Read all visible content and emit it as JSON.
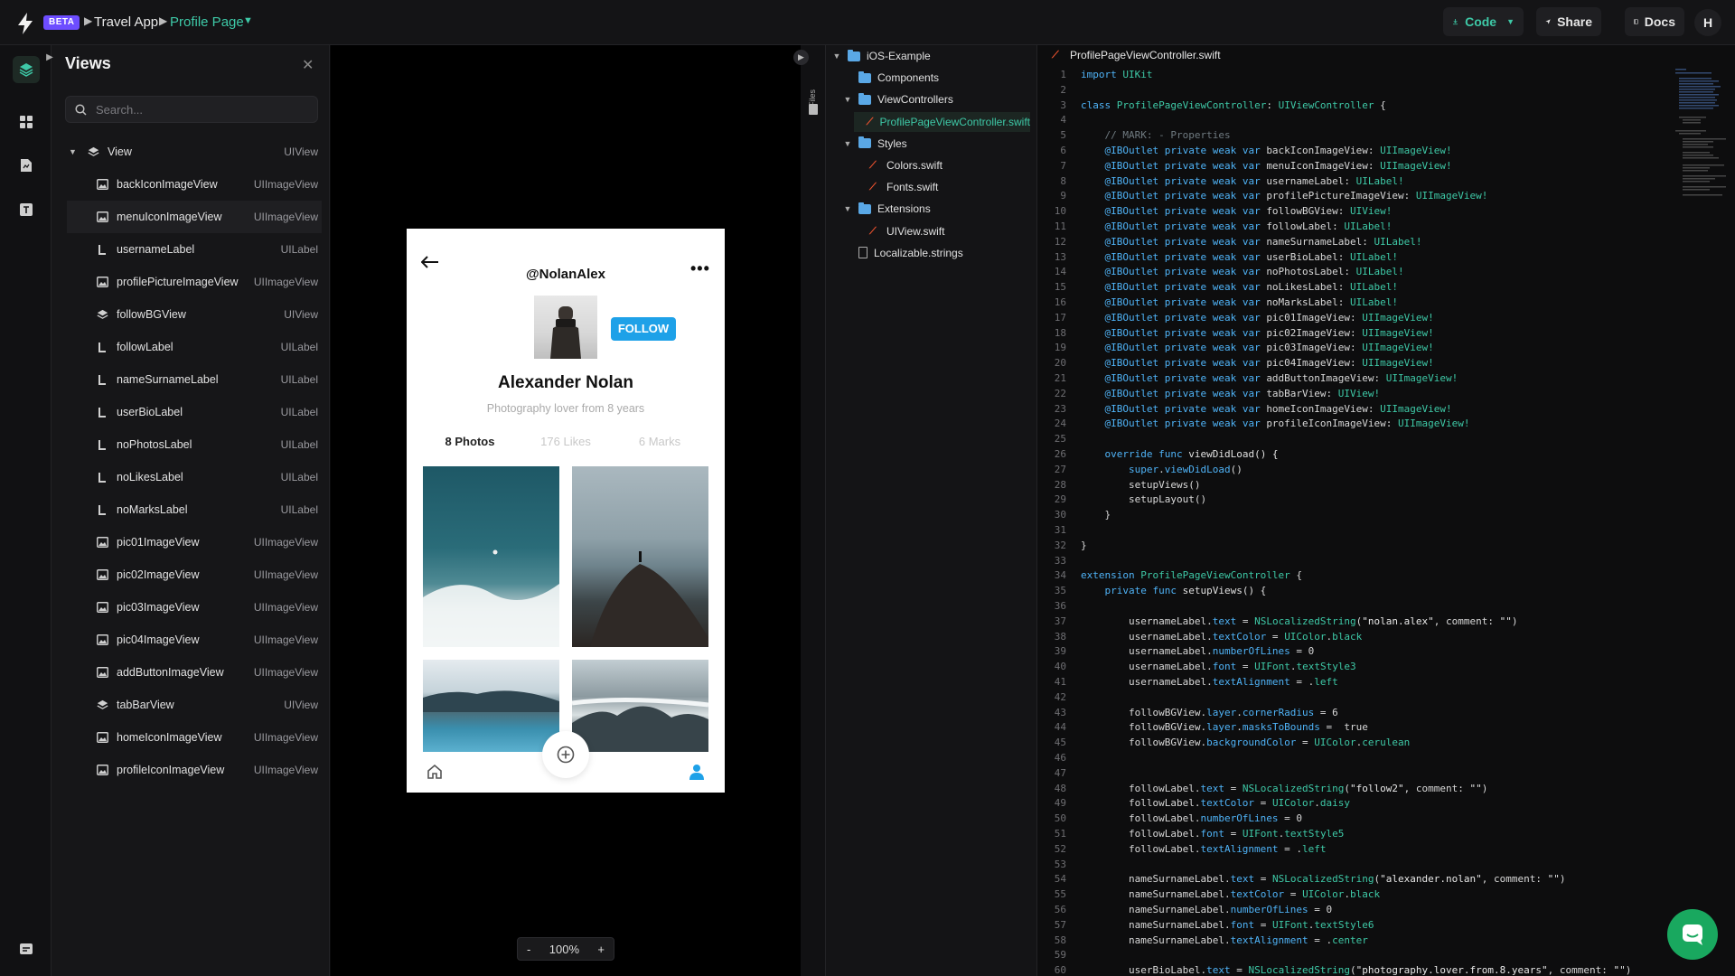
{
  "topbar": {
    "beta": "BETA",
    "crumb_app": "Travel App",
    "crumb_page": "Profile Page",
    "code_label": "Code",
    "share_label": "Share",
    "docs_label": "Docs",
    "avatar_letter": "H"
  },
  "views": {
    "title": "Views",
    "search_placeholder": "Search...",
    "items": [
      {
        "name": "View",
        "type": "UIView",
        "icon": "layers-icon"
      },
      {
        "name": "backIconImageView",
        "type": "UIImageView",
        "icon": "image-icon"
      },
      {
        "name": "menuIconImageView",
        "type": "UIImageView",
        "icon": "image-icon"
      },
      {
        "name": "usernameLabel",
        "type": "UILabel",
        "icon": "label-icon"
      },
      {
        "name": "profilePictureImageView",
        "type": "UIImageView",
        "icon": "image-icon"
      },
      {
        "name": "followBGView",
        "type": "UIView",
        "icon": "layers-icon"
      },
      {
        "name": "followLabel",
        "type": "UILabel",
        "icon": "label-icon"
      },
      {
        "name": "nameSurnameLabel",
        "type": "UILabel",
        "icon": "label-icon"
      },
      {
        "name": "userBioLabel",
        "type": "UILabel",
        "icon": "label-icon"
      },
      {
        "name": "noPhotosLabel",
        "type": "UILabel",
        "icon": "label-icon"
      },
      {
        "name": "noLikesLabel",
        "type": "UILabel",
        "icon": "label-icon"
      },
      {
        "name": "noMarksLabel",
        "type": "UILabel",
        "icon": "label-icon"
      },
      {
        "name": "pic01ImageView",
        "type": "UIImageView",
        "icon": "image-icon"
      },
      {
        "name": "pic02ImageView",
        "type": "UIImageView",
        "icon": "image-icon"
      },
      {
        "name": "pic03ImageView",
        "type": "UIImageView",
        "icon": "image-icon"
      },
      {
        "name": "pic04ImageView",
        "type": "UIImageView",
        "icon": "image-icon"
      },
      {
        "name": "addButtonImageView",
        "type": "UIImageView",
        "icon": "image-icon"
      },
      {
        "name": "tabBarView",
        "type": "UIView",
        "icon": "layers-icon"
      },
      {
        "name": "homeIconImageView",
        "type": "UIImageView",
        "icon": "image-icon"
      },
      {
        "name": "profileIconImageView",
        "type": "UIImageView",
        "icon": "image-icon"
      }
    ]
  },
  "phone": {
    "username": "@NolanAlex",
    "follow": "FOLLOW",
    "name": "Alexander Nolan",
    "bio": "Photography lover from 8 years",
    "photos": "8 Photos",
    "likes": "176 Likes",
    "marks": "6 Marks"
  },
  "zoom": {
    "minus": "-",
    "value": "100%",
    "plus": "+"
  },
  "files_label": "Files",
  "tree": [
    {
      "label": "iOS-Example",
      "kind": "folder",
      "depth": 0,
      "chev": "▼"
    },
    {
      "label": "Components",
      "kind": "folder",
      "depth": 1,
      "chev": ""
    },
    {
      "label": "ViewControllers",
      "kind": "folder",
      "depth": 1,
      "chev": "▼"
    },
    {
      "label": "ProfilePageViewController.swift",
      "kind": "swift",
      "depth": 2,
      "chev": "",
      "selected": true
    },
    {
      "label": "Styles",
      "kind": "folder",
      "depth": 1,
      "chev": "▼"
    },
    {
      "label": "Colors.swift",
      "kind": "swift",
      "depth": 2,
      "chev": ""
    },
    {
      "label": "Fonts.swift",
      "kind": "swift",
      "depth": 2,
      "chev": ""
    },
    {
      "label": "Extensions",
      "kind": "folder",
      "depth": 1,
      "chev": "▼"
    },
    {
      "label": "UIView.swift",
      "kind": "swift",
      "depth": 2,
      "chev": ""
    },
    {
      "label": "Localizable.strings",
      "kind": "doc",
      "depth": 1,
      "chev": ""
    }
  ],
  "editor": {
    "filename": "ProfilePageViewController.swift",
    "lines": [
      [
        [
          "kw",
          "import "
        ],
        [
          "ty",
          "UIKit"
        ]
      ],
      [],
      [
        [
          "kw",
          "class "
        ],
        [
          "ty",
          "ProfilePageViewController"
        ],
        [
          "tx",
          ": "
        ],
        [
          "ty",
          "UIViewController"
        ],
        [
          "tx",
          " {"
        ]
      ],
      [],
      [
        [
          "tx",
          "    "
        ],
        [
          "cm",
          "// MARK: - Properties"
        ]
      ],
      [
        [
          "tx",
          "    "
        ],
        [
          "kw",
          "@IBOutlet private weak var "
        ],
        [
          "tx",
          "backIconImageView: "
        ],
        [
          "ty",
          "UIImageView!"
        ]
      ],
      [
        [
          "tx",
          "    "
        ],
        [
          "kw",
          "@IBOutlet private weak var "
        ],
        [
          "tx",
          "menuIconImageView: "
        ],
        [
          "ty",
          "UIImageView!"
        ]
      ],
      [
        [
          "tx",
          "    "
        ],
        [
          "kw",
          "@IBOutlet private weak var "
        ],
        [
          "tx",
          "usernameLabel: "
        ],
        [
          "ty",
          "UILabel!"
        ]
      ],
      [
        [
          "tx",
          "    "
        ],
        [
          "kw",
          "@IBOutlet private weak var "
        ],
        [
          "tx",
          "profilePictureImageView: "
        ],
        [
          "ty",
          "UIImageView!"
        ]
      ],
      [
        [
          "tx",
          "    "
        ],
        [
          "kw",
          "@IBOutlet private weak var "
        ],
        [
          "tx",
          "followBGView: "
        ],
        [
          "ty",
          "UIView!"
        ]
      ],
      [
        [
          "tx",
          "    "
        ],
        [
          "kw",
          "@IBOutlet private weak var "
        ],
        [
          "tx",
          "followLabel: "
        ],
        [
          "ty",
          "UILabel!"
        ]
      ],
      [
        [
          "tx",
          "    "
        ],
        [
          "kw",
          "@IBOutlet private weak var "
        ],
        [
          "tx",
          "nameSurnameLabel: "
        ],
        [
          "ty",
          "UILabel!"
        ]
      ],
      [
        [
          "tx",
          "    "
        ],
        [
          "kw",
          "@IBOutlet private weak var "
        ],
        [
          "tx",
          "userBioLabel: "
        ],
        [
          "ty",
          "UILabel!"
        ]
      ],
      [
        [
          "tx",
          "    "
        ],
        [
          "kw",
          "@IBOutlet private weak var "
        ],
        [
          "tx",
          "noPhotosLabel: "
        ],
        [
          "ty",
          "UILabel!"
        ]
      ],
      [
        [
          "tx",
          "    "
        ],
        [
          "kw",
          "@IBOutlet private weak var "
        ],
        [
          "tx",
          "noLikesLabel: "
        ],
        [
          "ty",
          "UILabel!"
        ]
      ],
      [
        [
          "tx",
          "    "
        ],
        [
          "kw",
          "@IBOutlet private weak var "
        ],
        [
          "tx",
          "noMarksLabel: "
        ],
        [
          "ty",
          "UILabel!"
        ]
      ],
      [
        [
          "tx",
          "    "
        ],
        [
          "kw",
          "@IBOutlet private weak var "
        ],
        [
          "tx",
          "pic01ImageView: "
        ],
        [
          "ty",
          "UIImageView!"
        ]
      ],
      [
        [
          "tx",
          "    "
        ],
        [
          "kw",
          "@IBOutlet private weak var "
        ],
        [
          "tx",
          "pic02ImageView: "
        ],
        [
          "ty",
          "UIImageView!"
        ]
      ],
      [
        [
          "tx",
          "    "
        ],
        [
          "kw",
          "@IBOutlet private weak var "
        ],
        [
          "tx",
          "pic03ImageView: "
        ],
        [
          "ty",
          "UIImageView!"
        ]
      ],
      [
        [
          "tx",
          "    "
        ],
        [
          "kw",
          "@IBOutlet private weak var "
        ],
        [
          "tx",
          "pic04ImageView: "
        ],
        [
          "ty",
          "UIImageView!"
        ]
      ],
      [
        [
          "tx",
          "    "
        ],
        [
          "kw",
          "@IBOutlet private weak var "
        ],
        [
          "tx",
          "addButtonImageView: "
        ],
        [
          "ty",
          "UIImageView!"
        ]
      ],
      [
        [
          "tx",
          "    "
        ],
        [
          "kw",
          "@IBOutlet private weak var "
        ],
        [
          "tx",
          "tabBarView: "
        ],
        [
          "ty",
          "UIView!"
        ]
      ],
      [
        [
          "tx",
          "    "
        ],
        [
          "kw",
          "@IBOutlet private weak var "
        ],
        [
          "tx",
          "homeIconImageView: "
        ],
        [
          "ty",
          "UIImageView!"
        ]
      ],
      [
        [
          "tx",
          "    "
        ],
        [
          "kw",
          "@IBOutlet private weak var "
        ],
        [
          "tx",
          "profileIconImageView: "
        ],
        [
          "ty",
          "UIImageView!"
        ]
      ],
      [],
      [
        [
          "tx",
          "    "
        ],
        [
          "kw",
          "override func "
        ],
        [
          "fn",
          "viewDidLoad() {"
        ]
      ],
      [
        [
          "tx",
          "        "
        ],
        [
          "kw",
          "super"
        ],
        [
          "tx",
          "."
        ],
        [
          "pr",
          "viewDidLoad"
        ],
        [
          "tx",
          "()"
        ]
      ],
      [
        [
          "tx",
          "        setupViews()"
        ]
      ],
      [
        [
          "tx",
          "        setupLayout()"
        ]
      ],
      [
        [
          "tx",
          "    }"
        ]
      ],
      [],
      [
        [
          "tx",
          "}"
        ]
      ],
      [],
      [
        [
          "kw",
          "extension "
        ],
        [
          "ty",
          "ProfilePageViewController"
        ],
        [
          "tx",
          " {"
        ]
      ],
      [
        [
          "tx",
          "    "
        ],
        [
          "kw",
          "private func "
        ],
        [
          "fn",
          "setupViews() {"
        ]
      ],
      [],
      [
        [
          "tx",
          "        usernameLabel."
        ],
        [
          "pr",
          "text"
        ],
        [
          "tx",
          " = "
        ],
        [
          "ty",
          "NSLocalizedString"
        ],
        [
          "tx",
          "("
        ],
        [
          "st",
          "\"nolan.alex\""
        ],
        [
          "tx",
          ", comment: "
        ],
        [
          "st",
          "\"\""
        ],
        [
          "tx",
          ")"
        ]
      ],
      [
        [
          "tx",
          "        usernameLabel."
        ],
        [
          "pr",
          "textColor"
        ],
        [
          "tx",
          " = "
        ],
        [
          "ty",
          "UIColor"
        ],
        [
          "tx",
          "."
        ],
        [
          "ty",
          "black"
        ]
      ],
      [
        [
          "tx",
          "        usernameLabel."
        ],
        [
          "pr",
          "numberOfLines"
        ],
        [
          "tx",
          " = 0"
        ]
      ],
      [
        [
          "tx",
          "        usernameLabel."
        ],
        [
          "pr",
          "font"
        ],
        [
          "tx",
          " = "
        ],
        [
          "ty",
          "UIFont"
        ],
        [
          "tx",
          "."
        ],
        [
          "ty",
          "textStyle3"
        ]
      ],
      [
        [
          "tx",
          "        usernameLabel."
        ],
        [
          "pr",
          "textAlignment"
        ],
        [
          "tx",
          " = ."
        ],
        [
          "ty",
          "left"
        ]
      ],
      [],
      [
        [
          "tx",
          "        followBGView."
        ],
        [
          "pr",
          "layer"
        ],
        [
          "tx",
          "."
        ],
        [
          "pr",
          "cornerRadius"
        ],
        [
          "tx",
          " = 6"
        ]
      ],
      [
        [
          "tx",
          "        followBGView."
        ],
        [
          "pr",
          "layer"
        ],
        [
          "tx",
          "."
        ],
        [
          "pr",
          "masksToBounds"
        ],
        [
          "tx",
          " =  true"
        ]
      ],
      [
        [
          "tx",
          "        followBGView."
        ],
        [
          "pr",
          "backgroundColor"
        ],
        [
          "tx",
          " = "
        ],
        [
          "ty",
          "UIColor"
        ],
        [
          "tx",
          "."
        ],
        [
          "ty",
          "cerulean"
        ]
      ],
      [],
      [],
      [
        [
          "tx",
          "        followLabel."
        ],
        [
          "pr",
          "text"
        ],
        [
          "tx",
          " = "
        ],
        [
          "ty",
          "NSLocalizedString"
        ],
        [
          "tx",
          "("
        ],
        [
          "st",
          "\"follow2\""
        ],
        [
          "tx",
          ", comment: "
        ],
        [
          "st",
          "\"\""
        ],
        [
          "tx",
          ")"
        ]
      ],
      [
        [
          "tx",
          "        followLabel."
        ],
        [
          "pr",
          "textColor"
        ],
        [
          "tx",
          " = "
        ],
        [
          "ty",
          "UIColor"
        ],
        [
          "tx",
          "."
        ],
        [
          "ty",
          "daisy"
        ]
      ],
      [
        [
          "tx",
          "        followLabel."
        ],
        [
          "pr",
          "numberOfLines"
        ],
        [
          "tx",
          " = 0"
        ]
      ],
      [
        [
          "tx",
          "        followLabel."
        ],
        [
          "pr",
          "font"
        ],
        [
          "tx",
          " = "
        ],
        [
          "ty",
          "UIFont"
        ],
        [
          "tx",
          "."
        ],
        [
          "ty",
          "textStyle5"
        ]
      ],
      [
        [
          "tx",
          "        followLabel."
        ],
        [
          "pr",
          "textAlignment"
        ],
        [
          "tx",
          " = ."
        ],
        [
          "ty",
          "left"
        ]
      ],
      [],
      [
        [
          "tx",
          "        nameSurnameLabel."
        ],
        [
          "pr",
          "text"
        ],
        [
          "tx",
          " = "
        ],
        [
          "ty",
          "NSLocalizedString"
        ],
        [
          "tx",
          "("
        ],
        [
          "st",
          "\"alexander.nolan\""
        ],
        [
          "tx",
          ", comment: "
        ],
        [
          "st",
          "\"\""
        ],
        [
          "tx",
          ")"
        ]
      ],
      [
        [
          "tx",
          "        nameSurnameLabel."
        ],
        [
          "pr",
          "textColor"
        ],
        [
          "tx",
          " = "
        ],
        [
          "ty",
          "UIColor"
        ],
        [
          "tx",
          "."
        ],
        [
          "ty",
          "black"
        ]
      ],
      [
        [
          "tx",
          "        nameSurnameLabel."
        ],
        [
          "pr",
          "numberOfLines"
        ],
        [
          "tx",
          " = 0"
        ]
      ],
      [
        [
          "tx",
          "        nameSurnameLabel."
        ],
        [
          "pr",
          "font"
        ],
        [
          "tx",
          " = "
        ],
        [
          "ty",
          "UIFont"
        ],
        [
          "tx",
          "."
        ],
        [
          "ty",
          "textStyle6"
        ]
      ],
      [
        [
          "tx",
          "        nameSurnameLabel."
        ],
        [
          "pr",
          "textAlignment"
        ],
        [
          "tx",
          " = ."
        ],
        [
          "ty",
          "center"
        ]
      ],
      [],
      [
        [
          "tx",
          "        userBioLabel."
        ],
        [
          "pr",
          "text"
        ],
        [
          "tx",
          " = "
        ],
        [
          "ty",
          "NSLocalizedString"
        ],
        [
          "tx",
          "("
        ],
        [
          "st",
          "\"photography.lover.from.8.years\""
        ],
        [
          "tx",
          ", comment: "
        ],
        [
          "st",
          "\"\""
        ],
        [
          "tx",
          ")"
        ]
      ]
    ]
  },
  "colors": {
    "accent": "#3ec9a7",
    "beta": "#6d4dff",
    "follow": "#1ea1e8",
    "keyword": "#4fb3f7",
    "chat": "#19a85f"
  }
}
